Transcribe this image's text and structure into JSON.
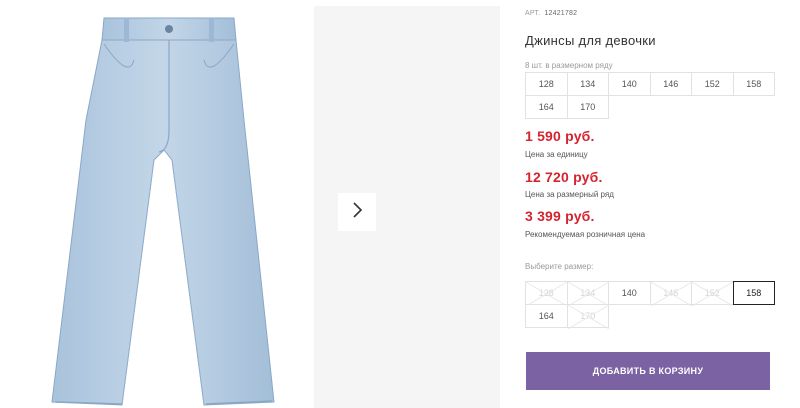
{
  "product": {
    "art_label": "АРТ.",
    "art_number": "12421782",
    "title": "Джинсы для девочки",
    "pack_label": "8 шт. в размерном ряду",
    "pack_sizes": [
      "128",
      "134",
      "140",
      "146",
      "152",
      "158",
      "164",
      "170"
    ]
  },
  "prices": {
    "unit_price": "1 590 руб.",
    "unit_label": "Цена за единицу",
    "row_price": "12 720 руб.",
    "row_label": "Цена за размерный ряд",
    "retail_price": "3 399 руб.",
    "retail_label": "Рекомендуемая розничная цена"
  },
  "size_select": {
    "label": "Выберите размер:",
    "sizes": [
      {
        "value": "128",
        "available": false
      },
      {
        "value": "134",
        "available": false
      },
      {
        "value": "140",
        "available": true
      },
      {
        "value": "146",
        "available": false
      },
      {
        "value": "152",
        "available": false
      },
      {
        "value": "158",
        "available": true,
        "selected": true
      },
      {
        "value": "164",
        "available": true
      },
      {
        "value": "170",
        "available": false
      }
    ]
  },
  "cart": {
    "button_label": "ДОБАВИТЬ В КОРЗИНУ"
  },
  "colors": {
    "price": "#d6242f",
    "cart_button": "#7b62a3"
  },
  "icons": {
    "next": "chevron-right-icon"
  }
}
